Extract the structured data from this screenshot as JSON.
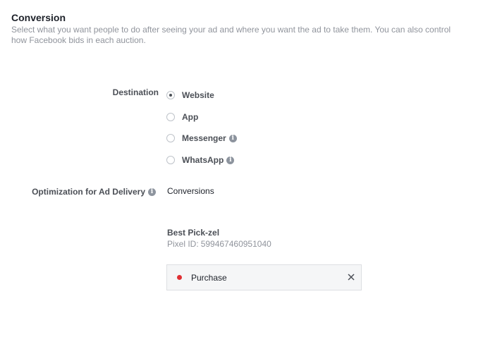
{
  "section": {
    "title": "Conversion",
    "description": "Select what you want people to do after seeing your ad and where you want the ad to take them. You can also control how Facebook bids in each auction."
  },
  "destination": {
    "label": "Destination",
    "selected": "Website",
    "options": [
      {
        "label": "Website",
        "checked": true,
        "info": false
      },
      {
        "label": "App",
        "checked": false,
        "info": false
      },
      {
        "label": "Messenger",
        "checked": false,
        "info": true
      },
      {
        "label": "WhatsApp",
        "checked": false,
        "info": true
      }
    ]
  },
  "optimization": {
    "label": "Optimization for Ad Delivery",
    "value": "Conversions"
  },
  "pixel": {
    "name": "Best Pick-zel",
    "id_label": "Pixel ID:",
    "id_value": "599467460951040"
  },
  "event": {
    "name": "Purchase",
    "status_color": "#e02f33"
  },
  "icons": {
    "info": "info-icon",
    "remove": "close-icon"
  }
}
